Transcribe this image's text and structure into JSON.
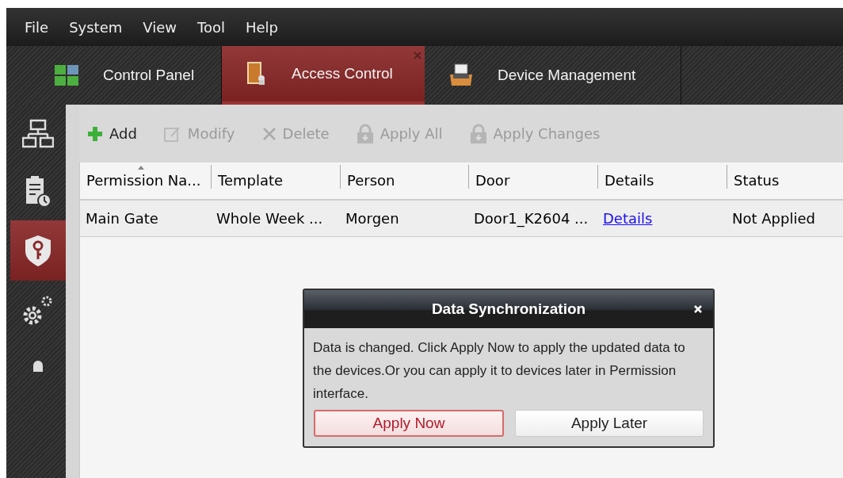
{
  "menu": [
    "File",
    "System",
    "View",
    "Tool",
    "Help"
  ],
  "tabs": [
    {
      "label": "Control Panel",
      "selected": false
    },
    {
      "label": "Access Control",
      "selected": true
    },
    {
      "label": "Device Management",
      "selected": false
    }
  ],
  "sidebar": {
    "items": [
      {
        "selected": false
      },
      {
        "selected": false
      },
      {
        "selected": true
      },
      {
        "selected": false
      },
      {
        "selected": false
      }
    ]
  },
  "toolbar": [
    {
      "label": "Add",
      "disabled": false
    },
    {
      "label": "Modify",
      "disabled": true
    },
    {
      "label": "Delete",
      "disabled": true
    },
    {
      "label": "Apply All",
      "disabled": true
    },
    {
      "label": "Apply Changes",
      "disabled": true
    }
  ],
  "table": {
    "columns": [
      {
        "label": "Permission Na...",
        "sorted": true
      },
      {
        "label": "Template",
        "sorted": false
      },
      {
        "label": "Person",
        "sorted": false
      },
      {
        "label": "Door",
        "sorted": false
      },
      {
        "label": "Details",
        "sorted": false
      },
      {
        "label": "Status",
        "sorted": false
      }
    ],
    "rows": [
      [
        {
          "text": "Main Gate",
          "kind": "text"
        },
        {
          "text": "Whole Week ...",
          "kind": "text"
        },
        {
          "text": "Morgen",
          "kind": "text"
        },
        {
          "text": "Door1_K2604 ...",
          "kind": "text"
        },
        {
          "text": "Details",
          "kind": "link"
        },
        {
          "text": "Not Applied",
          "kind": "text"
        }
      ]
    ]
  },
  "dialog": {
    "title": "Data Synchronization",
    "message": "Data is changed. Click Apply Now to apply the updated data to the devices.Or you can apply it to devices later in Permission interface.",
    "buttons": [
      {
        "label": "Apply Now",
        "primary": true
      },
      {
        "label": "Apply Later",
        "primary": false
      }
    ]
  }
}
